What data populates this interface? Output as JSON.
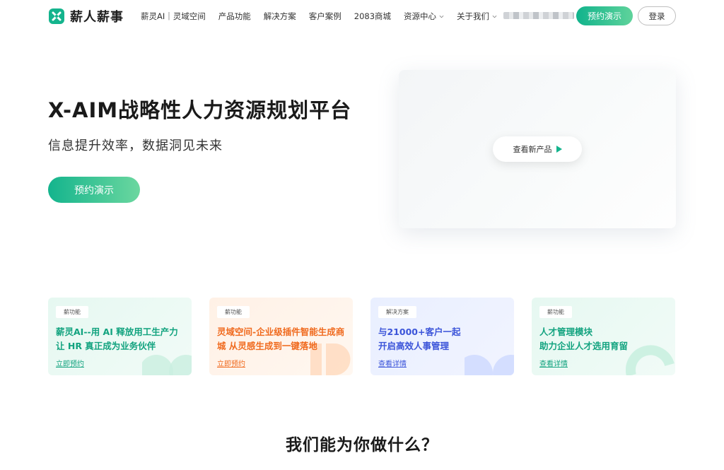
{
  "header": {
    "logo_text": "薪人薪事",
    "nav": [
      {
        "label": "薪灵AI｜灵域空间",
        "has_dropdown": false
      },
      {
        "label": "产品功能",
        "has_dropdown": false
      },
      {
        "label": "解决方案",
        "has_dropdown": false
      },
      {
        "label": "客户案例",
        "has_dropdown": false
      },
      {
        "label": "2083商城",
        "has_dropdown": false
      },
      {
        "label": "资源中心",
        "has_dropdown": true
      },
      {
        "label": "关于我们",
        "has_dropdown": true
      }
    ],
    "demo_button": "预约演示",
    "login_button": "登录"
  },
  "hero": {
    "title": "X-AIM战略性人力资源规划平台",
    "subtitle": "信息提升效率，数据洞见未来",
    "demo_button": "预约演示",
    "video_button": "查看新产品"
  },
  "cards": [
    {
      "tag": "薪功能",
      "line1": "薪灵AI--用 AI 释放用工生产力",
      "line2": "让 HR 真正成为业务伙伴",
      "link": "立即预约"
    },
    {
      "tag": "薪功能",
      "line1": "灵域空间-企业级插件智能生成商",
      "line2": "城 从灵感生成到一键落地",
      "link": "立即预约"
    },
    {
      "tag": "解决方案",
      "line1": "与21000+客户一起",
      "line2": "开启高效人事管理",
      "link": "查看详情"
    },
    {
      "tag": "薪功能",
      "line1": "人才管理模块",
      "line2": "助力企业人才选用育留",
      "link": "查看详情"
    }
  ],
  "section": {
    "title": "我们能为你做什么？"
  },
  "colors": {
    "brand_green": "#14b48d",
    "card_orange": "#f06a1e",
    "card_blue": "#3b54d9"
  },
  "icons": {
    "logo": "logo-icon",
    "dropdown": "chevron-down-icon",
    "play": "play-icon"
  }
}
